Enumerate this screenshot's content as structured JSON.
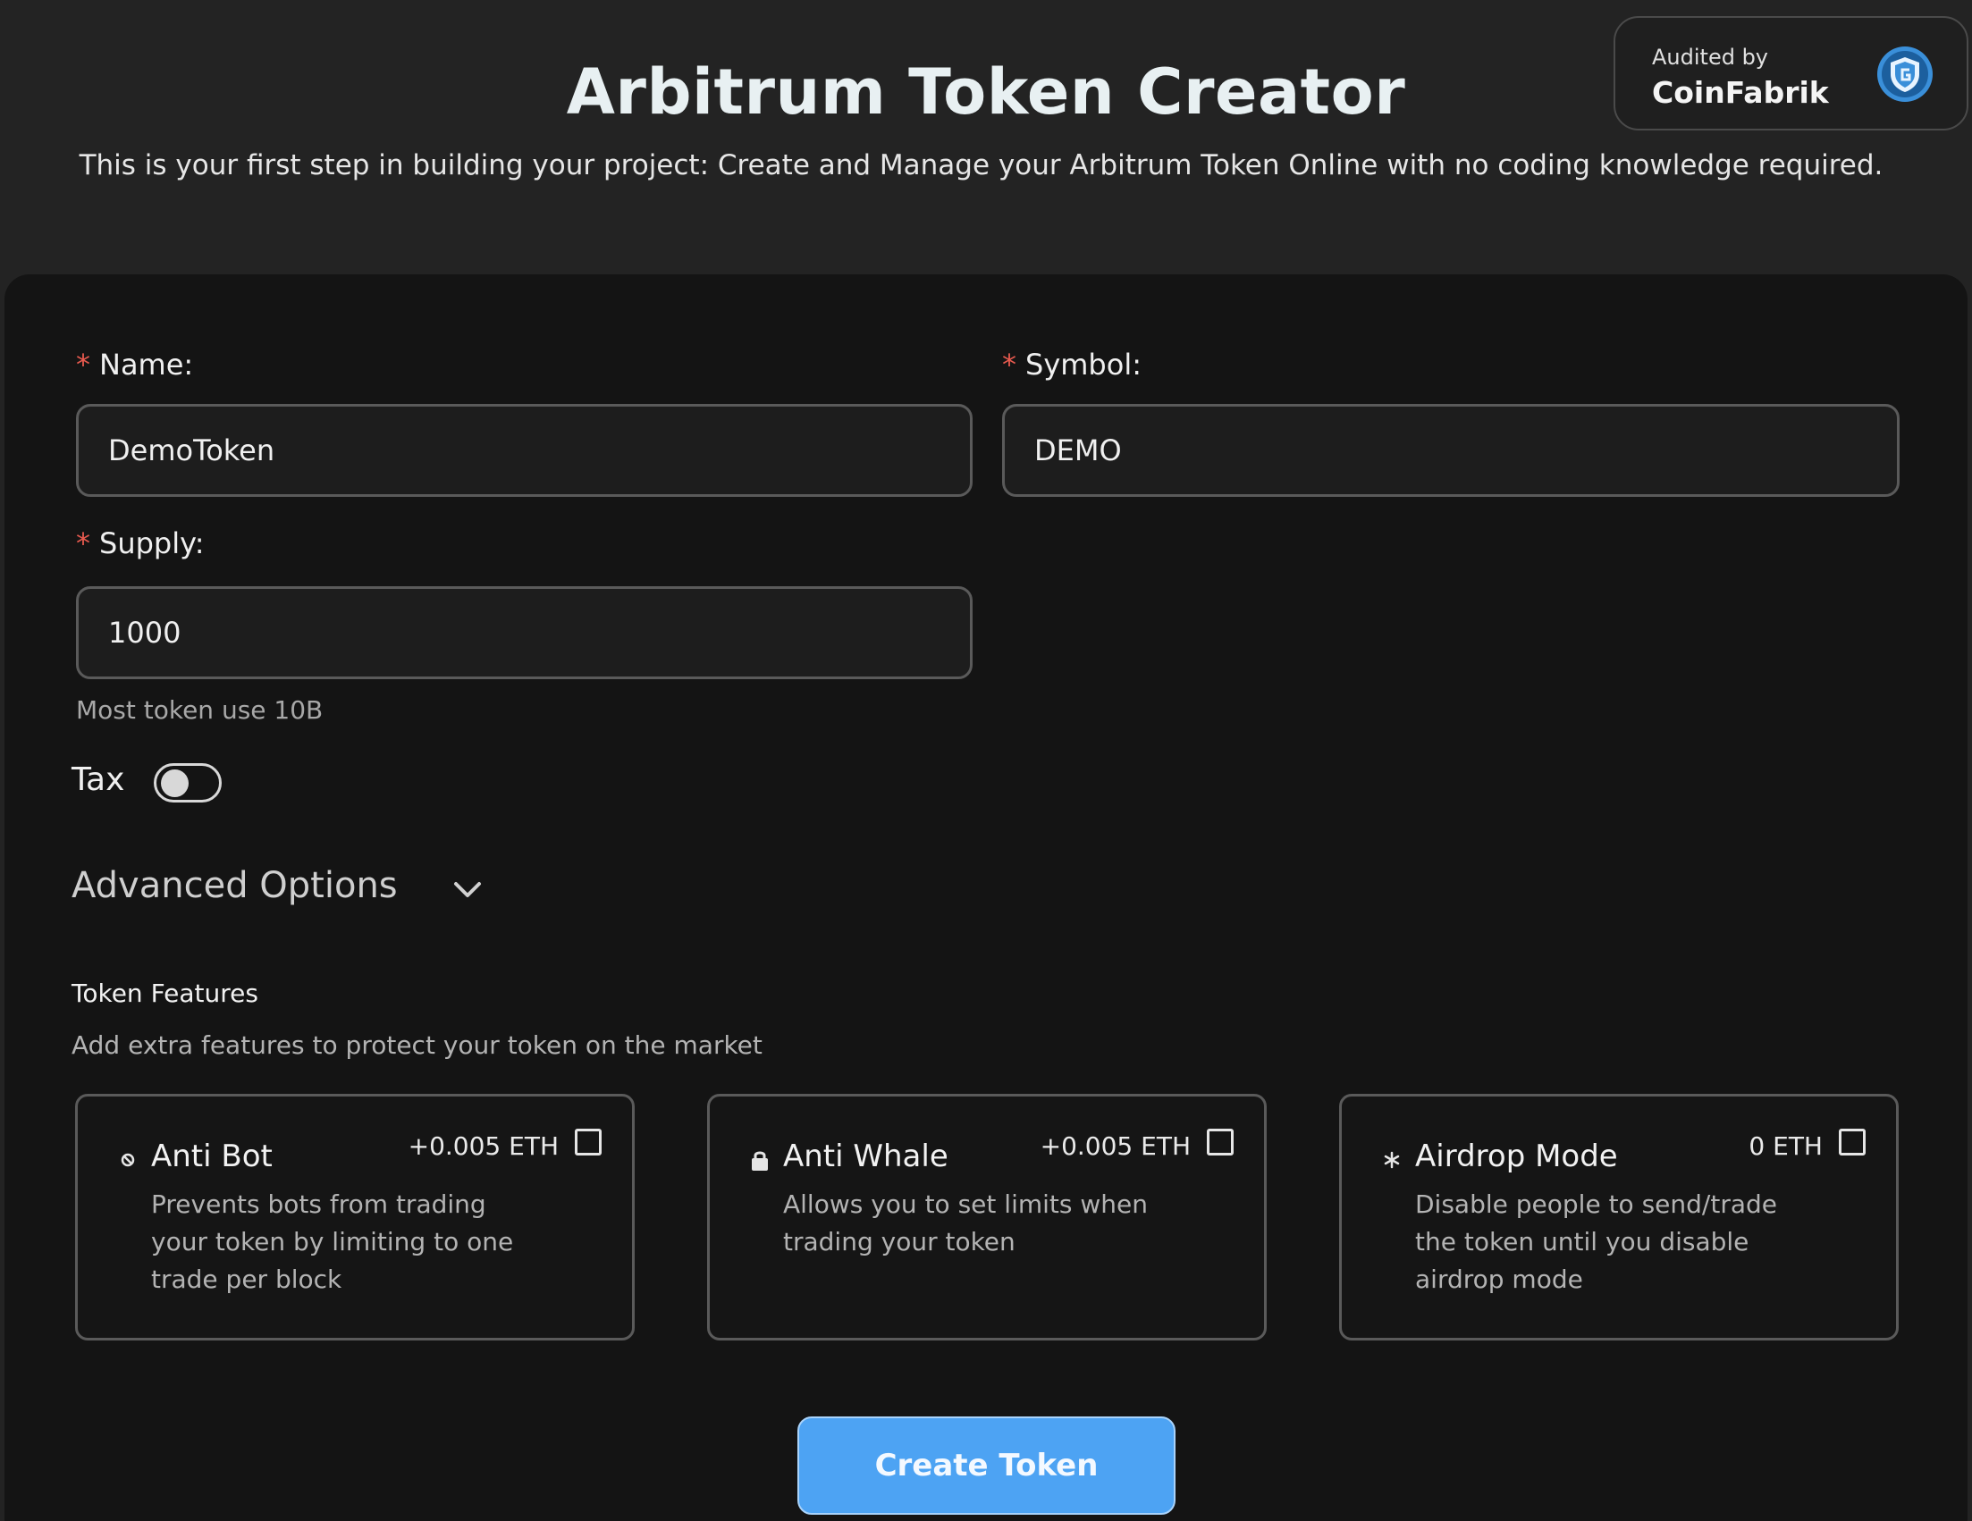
{
  "header": {
    "title": "Arbitrum Token Creator",
    "subtitle": "This is your first step in building your project: Create and Manage your Arbitrum Token Online with no coding knowledge required."
  },
  "audit": {
    "label": "Audited by",
    "name": "CoinFabrik",
    "logo_icon": "shield-logo-icon"
  },
  "form": {
    "name": {
      "required_mark": "*",
      "label": "Name:",
      "value": "DemoToken"
    },
    "symbol": {
      "required_mark": "*",
      "label": "Symbol:",
      "value": "DEMO"
    },
    "supply": {
      "required_mark": "*",
      "label": "Supply:",
      "value": "1000",
      "hint": "Most token use 10B"
    },
    "tax": {
      "label": "Tax",
      "enabled": false
    },
    "advanced": {
      "label": "Advanced Options",
      "icon": "chevron-down-icon"
    }
  },
  "features": {
    "title": "Token Features",
    "subtitle": "Add extra features to protect your token on the market",
    "items": [
      {
        "icon": "no-bot-icon",
        "title": "Anti Bot",
        "price": "+0.005 ETH",
        "checked": false,
        "description": "Prevents bots from trading your token by limiting to one trade per block"
      },
      {
        "icon": "lock-icon",
        "title": "Anti Whale",
        "price": "+0.005 ETH",
        "checked": false,
        "description": "Allows you to set limits when trading your token"
      },
      {
        "icon": "snowflake-icon",
        "title": "Airdrop Mode",
        "price": "0 ETH",
        "checked": false,
        "description": "Disable people to send/trade the token until you disable airdrop mode"
      }
    ]
  },
  "actions": {
    "create_label": "Create Token"
  },
  "colors": {
    "background": "#232323",
    "card": "#141414",
    "accent": "#4da3f3",
    "required": "#e85a4f"
  }
}
